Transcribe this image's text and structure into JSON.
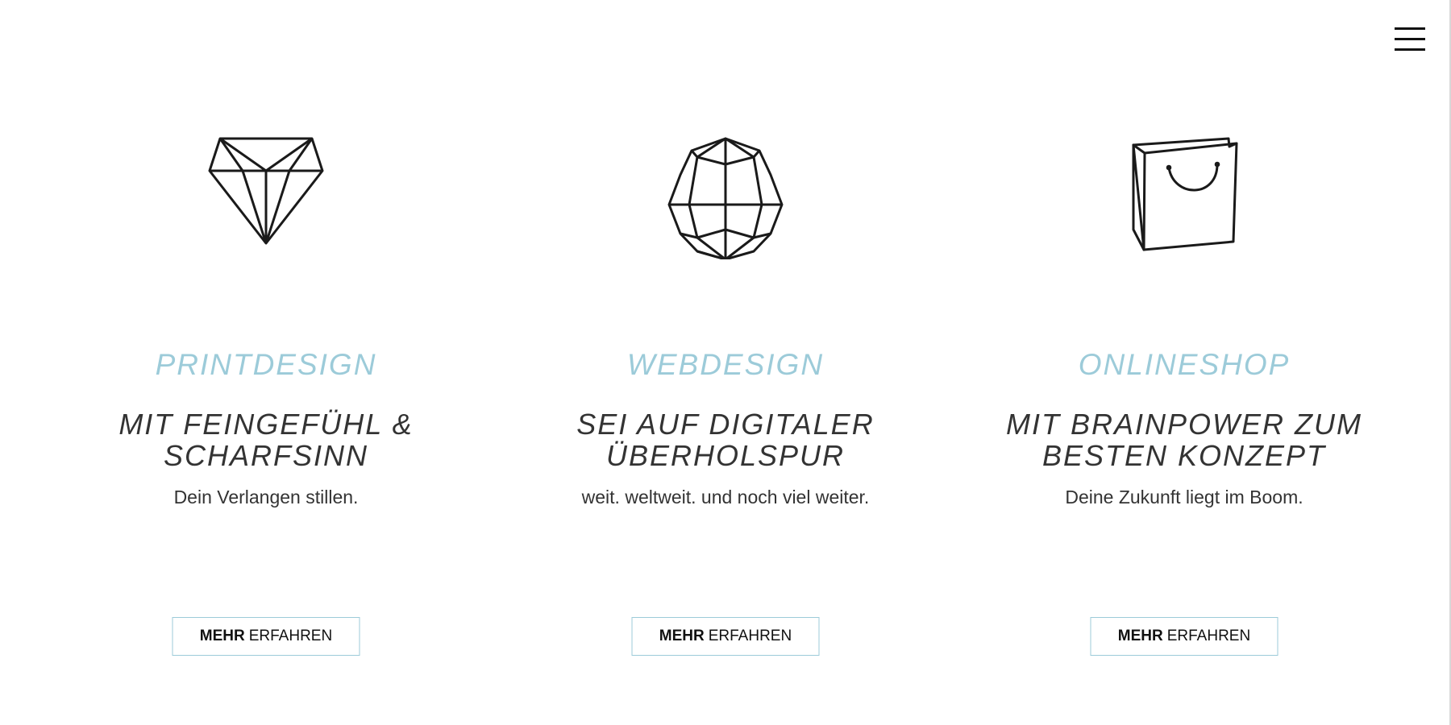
{
  "nav": {
    "menu_icon": "hamburger-menu-icon"
  },
  "accent_color": "#9ccbd9",
  "text_color": "#333333",
  "services": [
    {
      "icon": "diamond-icon",
      "category": "PRINTDESIGN",
      "headline_line1": "MIT FEINGEFÜHL &",
      "headline_line2": "SCHARFSINN",
      "tagline": "Dein Verlangen stillen.",
      "cta_strong": "MEHR",
      "cta_rest": "ERFAHREN"
    },
    {
      "icon": "globe-icon",
      "category": "WEBDESIGN",
      "headline_line1": "SEI AUF DIGITALER",
      "headline_line2": "ÜBERHOLSPUR",
      "tagline": "weit. weltweit. und noch viel weiter.",
      "cta_strong": "MEHR",
      "cta_rest": "ERFAHREN"
    },
    {
      "icon": "shopping-bag-icon",
      "category": "ONLINESHOP",
      "headline_line1": "MIT BRAINPOWER ZUM",
      "headline_line2": "BESTEN KONZEPT",
      "tagline": "Deine Zukunft liegt im Boom.",
      "cta_strong": "MEHR",
      "cta_rest": "ERFAHREN"
    }
  ]
}
